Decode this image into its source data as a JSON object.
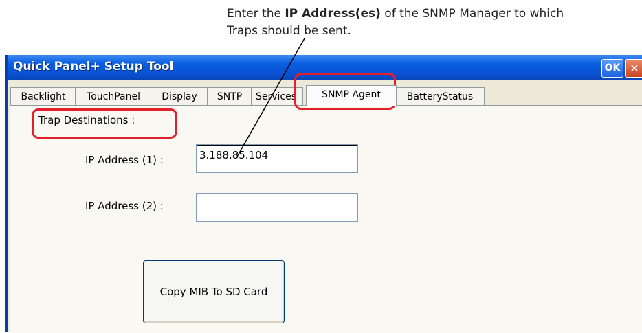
{
  "callout": {
    "prefix": "Enter the ",
    "bold": "IP Address(es)",
    "suffix": " of the SNMP Manager to which",
    "line2": "Traps should be sent."
  },
  "window": {
    "title": "Quick Panel+ Setup Tool",
    "ok_label": "OK",
    "close_label": "✕"
  },
  "tabs": [
    {
      "label": "Backlight"
    },
    {
      "label": "TouchPanel"
    },
    {
      "label": "Display"
    },
    {
      "label": "SNTP"
    },
    {
      "label": "Services"
    },
    {
      "label": "SNMP Agent"
    },
    {
      "label": "BatteryStatus"
    }
  ],
  "active_tab": "SNMP Agent",
  "form": {
    "section_label": "Trap Destinations :",
    "ip1_label": "IP Address (1) :",
    "ip1_value": "3.188.85.104",
    "ip2_label": "IP Address (2) :",
    "ip2_value": "",
    "copy_button_label": "Copy MIB To SD Card"
  },
  "colors": {
    "highlight": "#e21f2a",
    "titlebar": "#0a52d4"
  }
}
